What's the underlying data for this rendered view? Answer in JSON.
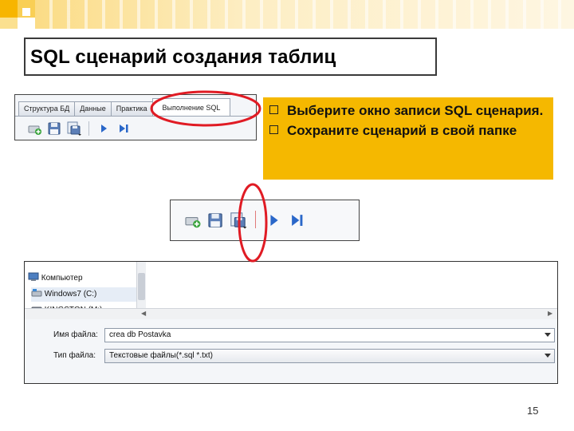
{
  "slide": {
    "title": "SQL сценарий создания таблиц",
    "page_number": "15",
    "accent_color": "#f5b800",
    "highlight_color": "#e01b24"
  },
  "toolbar_screenshot": {
    "tabs": [
      {
        "label": "Структура БД"
      },
      {
        "label": "Данные"
      },
      {
        "label": "Практика"
      },
      {
        "label": "Выполнение SQL"
      }
    ],
    "active_tab_index": 3,
    "icons": [
      "add-script-icon",
      "save-script-icon",
      "save-as-icon",
      "execute-icon",
      "execute-to-end-icon"
    ]
  },
  "callout": {
    "items": [
      {
        "text": "Выберите окно записи SQL сценария."
      },
      {
        "text": "Сохраните сценарий в свой папке"
      }
    ]
  },
  "file_dialog": {
    "tree_items": [
      {
        "label": "Компьютер",
        "icon": "computer-icon"
      },
      {
        "label": "Windows7 (C:)",
        "icon": "drive-icon"
      },
      {
        "label": "KINGSTON (M:)",
        "icon": "usb-drive-icon"
      }
    ],
    "selected_tree_index": 1,
    "filename_label": "Имя файла:",
    "filename_value": "crea db Postavka",
    "filetype_label": "Тип файла:",
    "filetype_value": "Текстовые файлы(*.sql *.txt)"
  }
}
